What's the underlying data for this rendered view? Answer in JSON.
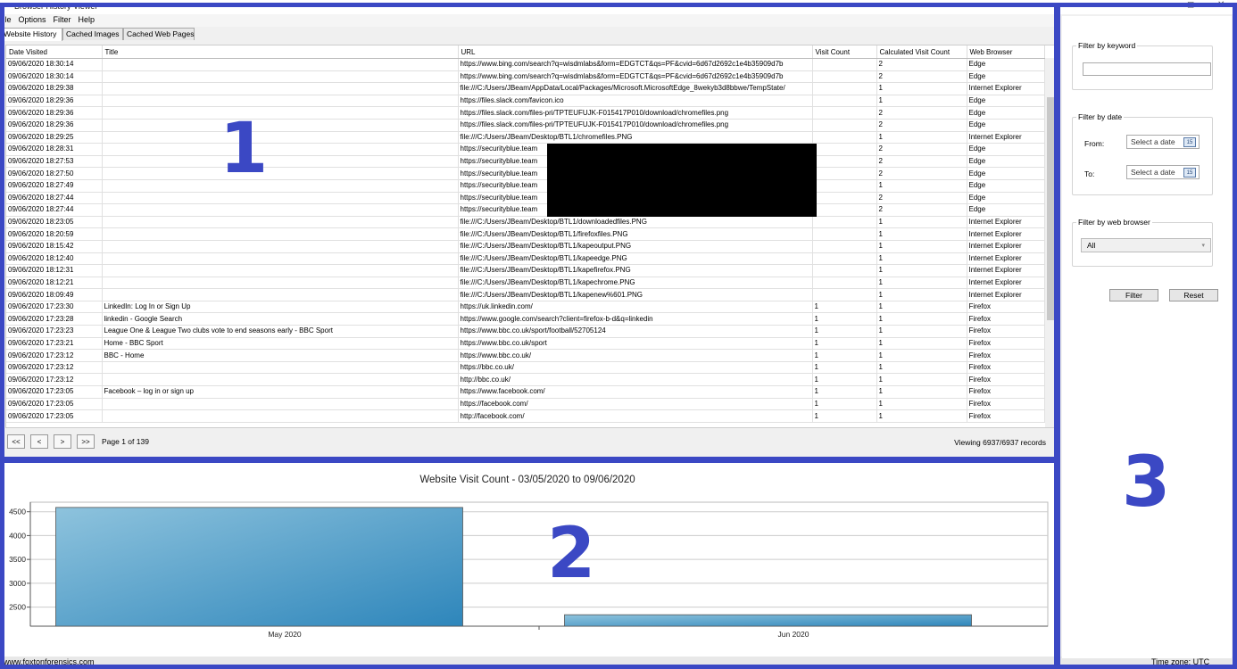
{
  "window": {
    "title": "Browser History Viewer"
  },
  "menu": [
    "File",
    "Options",
    "Filter",
    "Help"
  ],
  "tabs": [
    "Website History",
    "Cached Images",
    "Cached Web Pages"
  ],
  "grid": {
    "columns": [
      "Date Visited",
      "Title",
      "URL",
      "Visit Count",
      "Calculated Visit Count",
      "Web Browser"
    ],
    "rows": [
      [
        "09/06/2020 18:30:14",
        "",
        "https://www.bing.com/search?q=wisdmlabs&form=EDGTCT&qs=PF&cvid=6d67d2692c1e4b35909d7b",
        "",
        "2",
        "Edge"
      ],
      [
        "09/06/2020 18:30:14",
        "",
        "https://www.bing.com/search?q=wisdmlabs&form=EDGTCT&qs=PF&cvid=6d67d2692c1e4b35909d7b",
        "",
        "2",
        "Edge"
      ],
      [
        "09/06/2020 18:29:38",
        "",
        "file:///C:/Users/JBeam/AppData/Local/Packages/Microsoft.MicrosoftEdge_8wekyb3d8bbwe/TempState/",
        "",
        "1",
        "Internet Explorer"
      ],
      [
        "09/06/2020 18:29:36",
        "",
        "https://files.slack.com/favicon.ico",
        "",
        "1",
        "Edge"
      ],
      [
        "09/06/2020 18:29:36",
        "",
        "https://files.slack.com/files-pri/TPTEUFUJK-F015417P010/download/chromefiles.png",
        "",
        "2",
        "Edge"
      ],
      [
        "09/06/2020 18:29:36",
        "",
        "https://files.slack.com/files-pri/TPTEUFUJK-F015417P010/download/chromefiles.png",
        "",
        "2",
        "Edge"
      ],
      [
        "09/06/2020 18:29:25",
        "",
        "file:///C:/Users/JBeam/Desktop/BTL1/chromefiles.PNG",
        "",
        "1",
        "Internet Explorer"
      ],
      [
        "09/06/2020 18:28:31",
        "",
        "https://securityblue.team",
        "",
        "2",
        "Edge"
      ],
      [
        "09/06/2020 18:27:53",
        "",
        "https://securityblue.team",
        "",
        "2",
        "Edge"
      ],
      [
        "09/06/2020 18:27:50",
        "",
        "https://securityblue.team",
        "",
        "2",
        "Edge"
      ],
      [
        "09/06/2020 18:27:49",
        "",
        "https://securityblue.team",
        "",
        "1",
        "Edge"
      ],
      [
        "09/06/2020 18:27:44",
        "",
        "https://securityblue.team",
        "",
        "2",
        "Edge"
      ],
      [
        "09/06/2020 18:27:44",
        "",
        "https://securityblue.team",
        "",
        "2",
        "Edge"
      ],
      [
        "09/06/2020 18:23:05",
        "",
        "file:///C:/Users/JBeam/Desktop/BTL1/downloadedfiles.PNG",
        "",
        "1",
        "Internet Explorer"
      ],
      [
        "09/06/2020 18:20:59",
        "",
        "file:///C:/Users/JBeam/Desktop/BTL1/firefoxfiles.PNG",
        "",
        "1",
        "Internet Explorer"
      ],
      [
        "09/06/2020 18:15:42",
        "",
        "file:///C:/Users/JBeam/Desktop/BTL1/kapeoutput.PNG",
        "",
        "1",
        "Internet Explorer"
      ],
      [
        "09/06/2020 18:12:40",
        "",
        "file:///C:/Users/JBeam/Desktop/BTL1/kapeedge.PNG",
        "",
        "1",
        "Internet Explorer"
      ],
      [
        "09/06/2020 18:12:31",
        "",
        "file:///C:/Users/JBeam/Desktop/BTL1/kapefirefox.PNG",
        "",
        "1",
        "Internet Explorer"
      ],
      [
        "09/06/2020 18:12:21",
        "",
        "file:///C:/Users/JBeam/Desktop/BTL1/kapechrome.PNG",
        "",
        "1",
        "Internet Explorer"
      ],
      [
        "09/06/2020 18:09:49",
        "",
        "file:///C:/Users/JBeam/Desktop/BTL1/kapenew%601.PNG",
        "",
        "1",
        "Internet Explorer"
      ],
      [
        "09/06/2020 17:23:30",
        "LinkedIn: Log In or Sign Up",
        "https://uk.linkedin.com/",
        "1",
        "1",
        "Firefox"
      ],
      [
        "09/06/2020 17:23:28",
        "linkedin - Google Search",
        "https://www.google.com/search?client=firefox-b-d&q=linkedin",
        "1",
        "1",
        "Firefox"
      ],
      [
        "09/06/2020 17:23:23",
        "League One & League Two clubs vote to end seasons early - BBC Sport",
        "https://www.bbc.co.uk/sport/football/52705124",
        "1",
        "1",
        "Firefox"
      ],
      [
        "09/06/2020 17:23:21",
        "Home - BBC Sport",
        "https://www.bbc.co.uk/sport",
        "1",
        "1",
        "Firefox"
      ],
      [
        "09/06/2020 17:23:12",
        "BBC - Home",
        "https://www.bbc.co.uk/",
        "1",
        "1",
        "Firefox"
      ],
      [
        "09/06/2020 17:23:12",
        "",
        "https://bbc.co.uk/",
        "1",
        "1",
        "Firefox"
      ],
      [
        "09/06/2020 17:23:12",
        "",
        "http://bbc.co.uk/",
        "1",
        "1",
        "Firefox"
      ],
      [
        "09/06/2020 17:23:05",
        "Facebook – log in or sign up",
        "https://www.facebook.com/",
        "1",
        "1",
        "Firefox"
      ],
      [
        "09/06/2020 17:23:05",
        "",
        "https://facebook.com/",
        "1",
        "1",
        "Firefox"
      ],
      [
        "09/06/2020 17:23:05",
        "",
        "http://facebook.com/",
        "1",
        "1",
        "Firefox"
      ]
    ]
  },
  "pager": {
    "first": "<<",
    "prev": "<",
    "next": ">",
    "last": ">>",
    "page_text": "Page 1 of 139",
    "viewing": "Viewing 6937/6937 records"
  },
  "filters": {
    "keyword_legend": "Filter by keyword",
    "keyword_value": "",
    "date_legend": "Filter by date",
    "from_label": "From:",
    "to_label": "To:",
    "date_placeholder": "Select a date",
    "cal_glyph": "15",
    "browser_legend": "Filter by web browser",
    "browser_selected": "All",
    "filter_button": "Filter",
    "reset_button": "Reset"
  },
  "status": {
    "left": "www.foxtonforensics.com",
    "right": "Time zone: UTC"
  },
  "annotations": {
    "one": "1",
    "two": "2",
    "three": "3",
    "color": "#3b48c4"
  },
  "chart_data": {
    "type": "bar",
    "title": "Website Visit Count  -  03/05/2020 to 09/06/2020",
    "categories": [
      "May 2020",
      "Jun 2020"
    ],
    "values": [
      4590,
      2340
    ],
    "yticks": [
      2500,
      3000,
      3500,
      4000,
      4500
    ],
    "ylim": [
      2100,
      4700
    ],
    "grid": true,
    "bar_color": "#3b8fc0"
  }
}
